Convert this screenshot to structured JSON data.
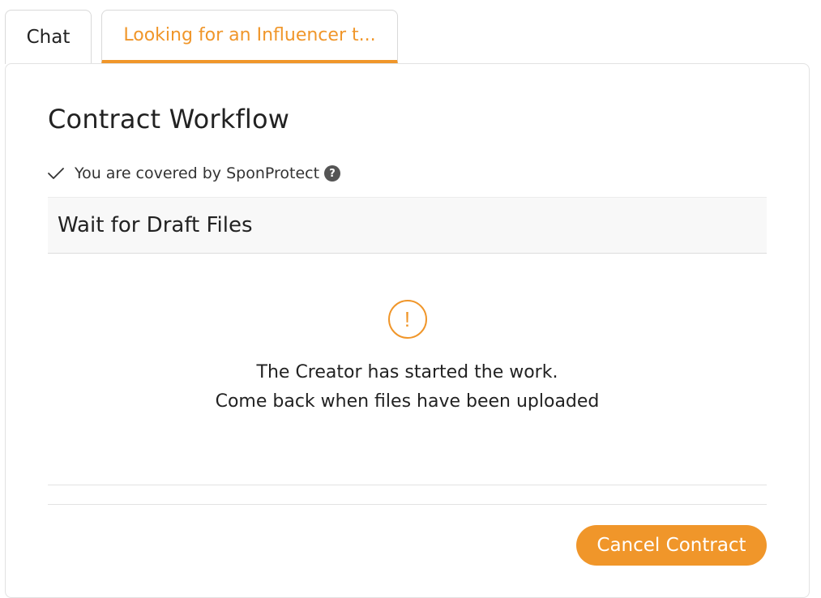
{
  "tabs": [
    {
      "label": "Chat",
      "active": false
    },
    {
      "label": "Looking for an Influencer t...",
      "active": true
    }
  ],
  "panel": {
    "title": "Contract Workflow",
    "coverage": {
      "icon": "check-icon",
      "text": "You are covered by SponProtect",
      "help_icon": "question-circle-icon",
      "help_glyph": "?"
    },
    "step": {
      "title": "Wait for Draft Files"
    },
    "notice": {
      "icon": "exclamation-circle-icon",
      "icon_glyph": "!",
      "line1": "The Creator has started the work.",
      "line2": "Come back when files have been uploaded"
    },
    "actions": {
      "cancel_label": "Cancel Contract"
    }
  },
  "colors": {
    "accent": "#f0962a",
    "text": "#222222",
    "step_bg": "#f8f8f8"
  }
}
